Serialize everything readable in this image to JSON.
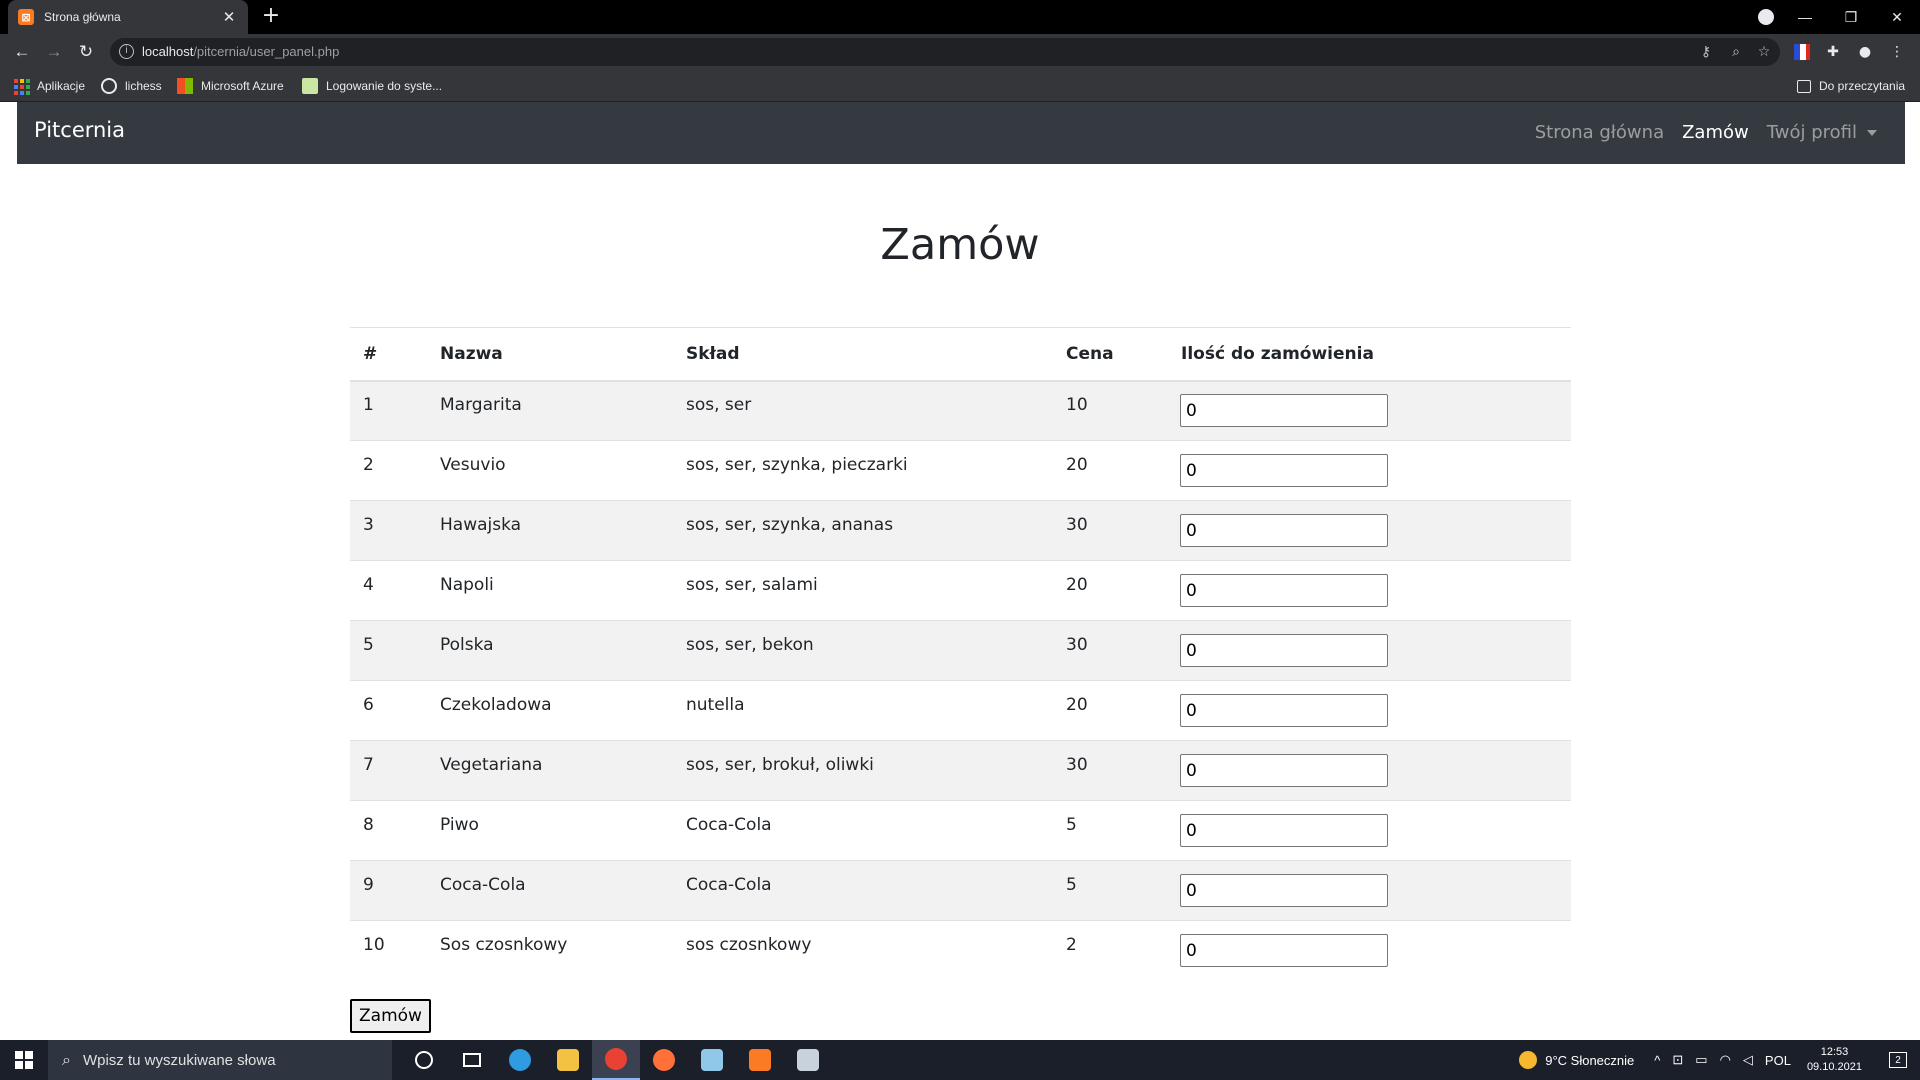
{
  "browser": {
    "tab_title": "Strona główna",
    "tab_close": "✕",
    "new_tab": "+",
    "url_host": "localhost",
    "url_path": "/pitcernia/user_panel.php",
    "back": "←",
    "forward": "→",
    "reload": "↻",
    "bookmarks": [
      {
        "label": "Aplikacje",
        "icon": "apps-grid-icon"
      },
      {
        "label": "lichess",
        "icon": "lichess-icon"
      },
      {
        "label": "Microsoft Azure",
        "icon": "azure-icon"
      },
      {
        "label": "Logowanie do syste...",
        "icon": "login-icon"
      }
    ],
    "reading_list": "Do przeczytania",
    "window_controls": {
      "minimize": "—",
      "restore": "❐",
      "close": "✕"
    }
  },
  "navbar": {
    "brand": "Pitcernia",
    "links": [
      {
        "label": "Strona główna",
        "active": false
      },
      {
        "label": "Zamów",
        "active": true
      },
      {
        "label": "Twój profil",
        "active": false,
        "dropdown": true
      }
    ]
  },
  "page": {
    "title": "Zamów",
    "table": {
      "headers": [
        "#",
        "Nazwa",
        "Skład",
        "Cena",
        "Ilość do zamówienia"
      ],
      "rows": [
        {
          "id": "1",
          "name": "Margarita",
          "ingredients": "sos, ser",
          "price": "10",
          "qty": "0"
        },
        {
          "id": "2",
          "name": "Vesuvio",
          "ingredients": "sos, ser, szynka, pieczarki",
          "price": "20",
          "qty": "0"
        },
        {
          "id": "3",
          "name": "Hawajska",
          "ingredients": "sos, ser, szynka, ananas",
          "price": "30",
          "qty": "0"
        },
        {
          "id": "4",
          "name": "Napoli",
          "ingredients": "sos, ser, salami",
          "price": "20",
          "qty": "0"
        },
        {
          "id": "5",
          "name": "Polska",
          "ingredients": "sos, ser, bekon",
          "price": "30",
          "qty": "0"
        },
        {
          "id": "6",
          "name": "Czekoladowa",
          "ingredients": "nutella",
          "price": "20",
          "qty": "0"
        },
        {
          "id": "7",
          "name": "Vegetariana",
          "ingredients": "sos, ser, brokuł, oliwki",
          "price": "30",
          "qty": "0"
        },
        {
          "id": "8",
          "name": "Piwo",
          "ingredients": "Coca-Cola",
          "price": "5",
          "qty": "0"
        },
        {
          "id": "9",
          "name": "Coca-Cola",
          "ingredients": "Coca-Cola",
          "price": "5",
          "qty": "0"
        },
        {
          "id": "10",
          "name": "Sos czosnkowy",
          "ingredients": "sos czosnkowy",
          "price": "2",
          "qty": "0"
        }
      ]
    },
    "submit_label": "Zamów"
  },
  "taskbar": {
    "search_placeholder": "Wpisz tu wyszukiwane słowa",
    "weather": "9°C  Słonecznie",
    "language": "POL",
    "time": "12:53",
    "date": "09.10.2021",
    "notification_count": "2",
    "apps": [
      {
        "name": "cortana-icon",
        "color": "#ffffff"
      },
      {
        "name": "task-view-icon",
        "color": "#ffffff"
      },
      {
        "name": "edge-icon",
        "color": "#2f9be0"
      },
      {
        "name": "file-explorer-icon",
        "color": "#f3c242"
      },
      {
        "name": "chrome-icon",
        "color": "#e94235"
      },
      {
        "name": "firefox-icon",
        "color": "#ff7139"
      },
      {
        "name": "notepad-icon",
        "color": "#8fc8e8"
      },
      {
        "name": "xampp-icon",
        "color": "#fb7a24"
      },
      {
        "name": "paint-icon",
        "color": "#c7d2dd"
      }
    ]
  },
  "colors": {
    "navbar_bg": "#343a40",
    "striped_row": "#f2f2f2",
    "chrome_bg": "#35363a",
    "taskbar_bg": "#1b1f2a"
  }
}
